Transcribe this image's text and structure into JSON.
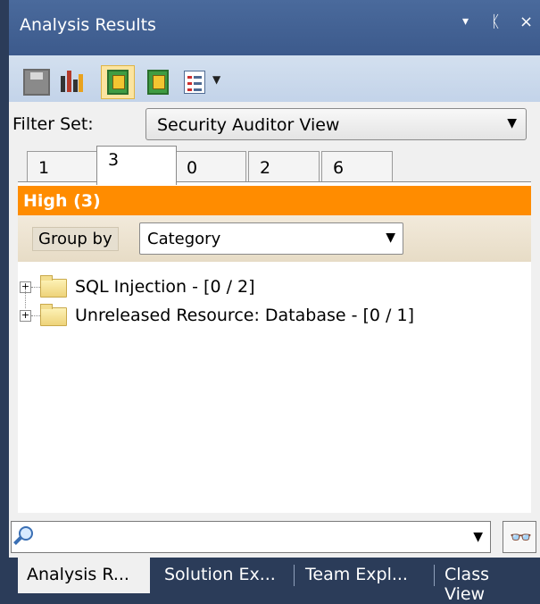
{
  "window": {
    "title": "Analysis Results",
    "controls": [
      "▾",
      "ᛕ",
      "×"
    ]
  },
  "filter": {
    "label": "Filter Set:",
    "selected": "Security Auditor View"
  },
  "tabs": [
    {
      "label": "1",
      "active": false
    },
    {
      "label": "3",
      "active": true
    },
    {
      "label": "0",
      "active": false
    },
    {
      "label": "2",
      "active": false
    },
    {
      "label": "6",
      "active": false
    }
  ],
  "severity": {
    "text": "High  (3)",
    "color": "#ff8c00"
  },
  "group_by": {
    "label": "Group by",
    "selected": "Category"
  },
  "tree": [
    {
      "label": "SQL Injection - [0 / 2]"
    },
    {
      "label": "Unreleased Resource: Database - [0 / 1]"
    }
  ],
  "search": {
    "value": "",
    "icon": "magnifier-icon",
    "find_icon": "binoculars-icon"
  },
  "bottom_tabs": [
    {
      "label": "Analysis R...",
      "active": true
    },
    {
      "label": "Solution Ex...",
      "active": false
    },
    {
      "label": "Team Expl...",
      "active": false
    },
    {
      "label": "Class View",
      "active": false
    }
  ]
}
